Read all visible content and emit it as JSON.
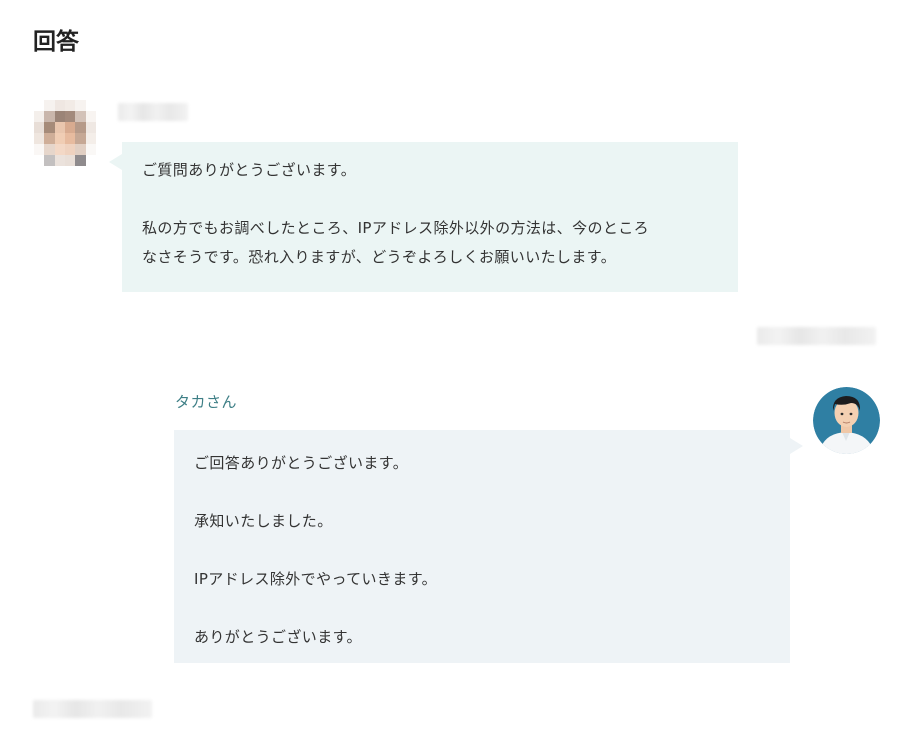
{
  "page": {
    "title": "回答"
  },
  "answer": {
    "author_name": "",
    "body_line_1": "ご質問ありがとうございます。",
    "body_line_2": "私の方でもお調べしたところ、IPアドレス除外以外の方法は、今のところ",
    "body_line_3": "なさそうです。恐れ入りますが、どうぞよろしくお願いいたします。"
  },
  "reply": {
    "author_name": "タカさん",
    "body_line_1": "ご回答ありがとうございます。",
    "body_line_2": "承知いたしました。",
    "body_line_3": "IPアドレス除外でやっていきます。",
    "body_line_4": "ありがとうございます。"
  },
  "colors": {
    "answer_bubble_bg": "#ebf5f4",
    "reply_bubble_bg": "#eef3f6",
    "reply_name_color": "#3e7f86"
  },
  "icons": {
    "answerer_avatar": "pixelated-avatar-icon",
    "replier_avatar": "illustrated-man-avatar-icon"
  }
}
